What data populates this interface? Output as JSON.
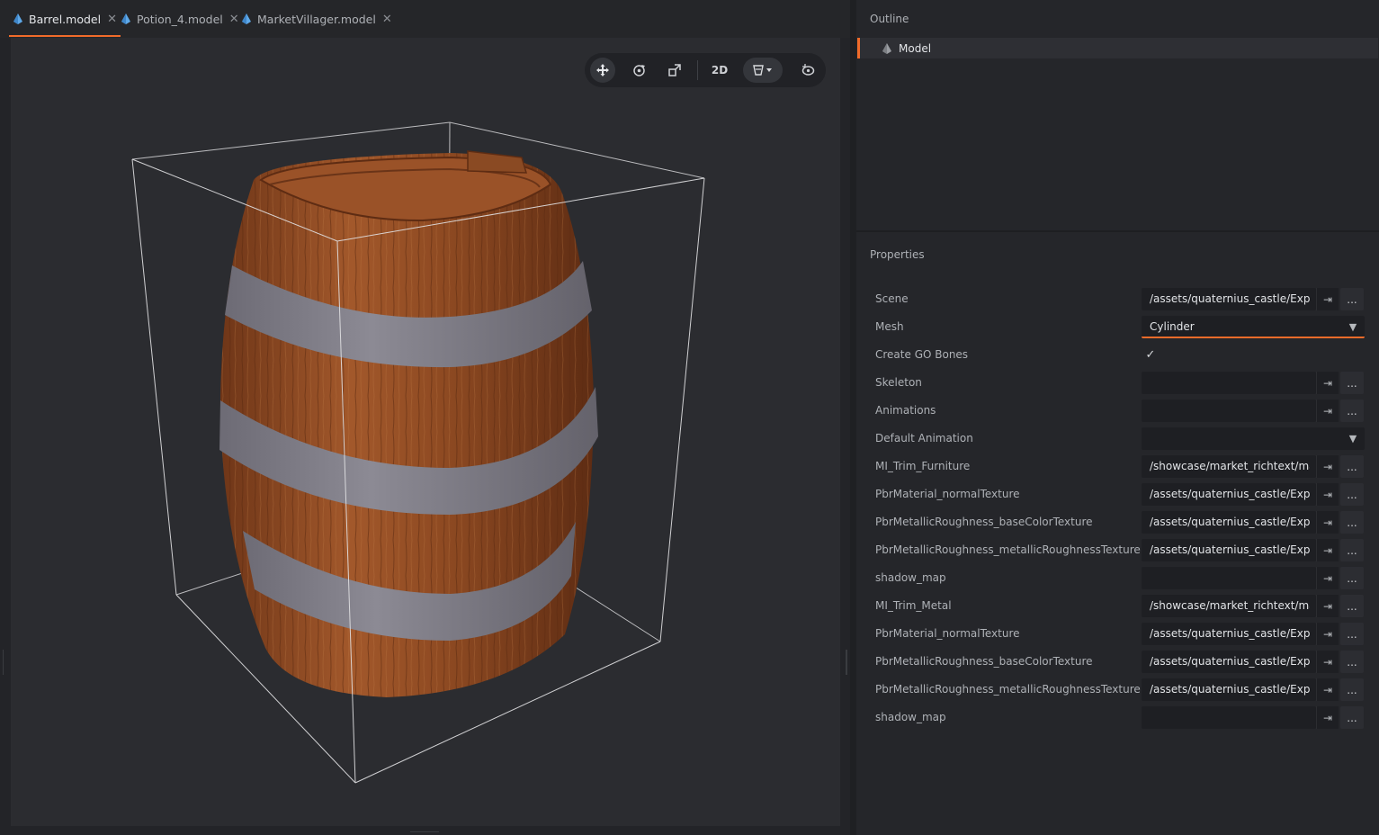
{
  "tabs": [
    {
      "label": "Barrel.model",
      "active": true
    },
    {
      "label": "Potion_4.model",
      "active": false
    },
    {
      "label": "MarketVillager.model",
      "active": false
    }
  ],
  "toolbar": {
    "move_icon": "move-icon",
    "rotate_icon": "rotate-icon",
    "scale_icon": "scale-icon",
    "mode_2d": "2D",
    "visibility_icon": "visibility-filter-icon",
    "camera_icon": "camera-reset-icon"
  },
  "outline": {
    "title": "Outline",
    "items": [
      {
        "label": "Model",
        "icon": "model-icon"
      }
    ]
  },
  "properties": {
    "title": "Properties",
    "rows": [
      {
        "label": "Scene",
        "value": "/assets/quaternius_castle/Expor",
        "kind": "resource"
      },
      {
        "label": "Mesh",
        "value": "Cylinder",
        "kind": "dropdown"
      },
      {
        "label": "Create GO Bones",
        "value": "✓",
        "kind": "checkbox"
      },
      {
        "label": "Skeleton",
        "value": "",
        "kind": "resource"
      },
      {
        "label": "Animations",
        "value": "",
        "kind": "resource"
      },
      {
        "label": "Default Animation",
        "value": "",
        "kind": "dropdown"
      },
      {
        "label": "MI_Trim_Furniture",
        "value": "/showcase/market_richtext/mat",
        "kind": "resource"
      },
      {
        "label": "PbrMaterial_normalTexture",
        "value": "/assets/quaternius_castle/Expor",
        "kind": "resource"
      },
      {
        "label": "PbrMetallicRoughness_baseColorTexture",
        "value": "/assets/quaternius_castle/Expor",
        "kind": "resource"
      },
      {
        "label": "PbrMetallicRoughness_metallicRoughnessTexture",
        "value": "/assets/quaternius_castle/Expor",
        "kind": "resource"
      },
      {
        "label": "shadow_map",
        "value": "",
        "kind": "resource"
      },
      {
        "label": "MI_Trim_Metal",
        "value": "/showcase/market_richtext/mat",
        "kind": "resource"
      },
      {
        "label": "PbrMaterial_normalTexture",
        "value": "/assets/quaternius_castle/Expor",
        "kind": "resource"
      },
      {
        "label": "PbrMetallicRoughness_baseColorTexture",
        "value": "/assets/quaternius_castle/Expor",
        "kind": "resource"
      },
      {
        "label": "PbrMetallicRoughness_metallicRoughnessTexture",
        "value": "/assets/quaternius_castle/Expor",
        "kind": "resource"
      },
      {
        "label": "shadow_map",
        "value": "",
        "kind": "resource"
      }
    ]
  },
  "colors": {
    "accent": "#f06b2a",
    "wood": "#8a4a23",
    "metal": "#7e7c86"
  },
  "icons": {
    "more": "...",
    "goto": "goto-resource-icon",
    "dropdown": "chevron-down-icon"
  }
}
